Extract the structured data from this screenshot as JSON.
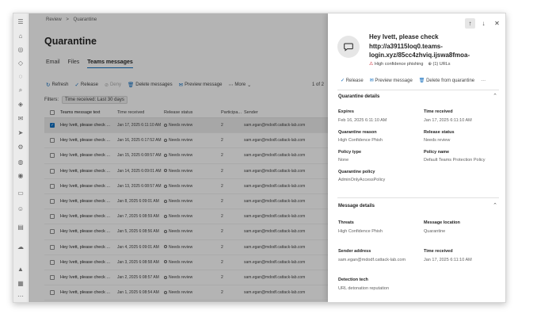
{
  "breadcrumb": {
    "parent": "Review",
    "sep": ">",
    "current": "Quarantine"
  },
  "page_title": "Quarantine",
  "tabs": [
    {
      "label": "Email"
    },
    {
      "label": "Files"
    },
    {
      "label": "Teams messages"
    }
  ],
  "toolbar": {
    "refresh": "Refresh",
    "release": "Release",
    "deny": "Deny",
    "delete": "Delete messages",
    "preview": "Preview message",
    "more": "More",
    "pager": "1 of 2"
  },
  "filters": {
    "label": "Filters:",
    "pill": "Time received: Last 30 days"
  },
  "table": {
    "headers": {
      "text": "Teams message text",
      "time": "Time received",
      "status": "Release status",
      "participants": "Participa...",
      "sender": "Sender"
    },
    "rows": [
      {
        "text": "Hey Ivett, please check ...",
        "time": "Jan 17, 2025 6:11:10 AM",
        "status": "Needs review",
        "participants": "2",
        "sender": "sam.egan@mdodf.cattack-lab.com",
        "selected": true
      },
      {
        "text": "Hey Ivett, please check ...",
        "time": "Jan 16, 2025 6:17:52 AM",
        "status": "Needs review",
        "participants": "2",
        "sender": "sam.egan@mdodf.cattack-lab.com",
        "selected": false
      },
      {
        "text": "Hey Ivett, please check ...",
        "time": "Jan 15, 2025 6:08:57 AM",
        "status": "Needs review",
        "participants": "2",
        "sender": "sam.egan@mdodf.cattack-lab.com",
        "selected": false
      },
      {
        "text": "Hey Ivett, please check ...",
        "time": "Jan 14, 2025 6:09:01 AM",
        "status": "Needs review",
        "participants": "2",
        "sender": "sam.egan@mdodf.cattack-lab.com",
        "selected": false
      },
      {
        "text": "Hey Ivett, please check ...",
        "time": "Jan 13, 2025 6:08:57 AM",
        "status": "Needs review",
        "participants": "2",
        "sender": "sam.egan@mdodf.cattack-lab.com",
        "selected": false
      },
      {
        "text": "Hey Ivett, please check ...",
        "time": "Jan 8, 2025 6:09:01 AM",
        "status": "Needs review",
        "participants": "2",
        "sender": "sam.egan@mdodf.cattack-lab.com",
        "selected": false
      },
      {
        "text": "Hey Ivett, please check ...",
        "time": "Jan 7, 2025 6:08:59 AM",
        "status": "Needs review",
        "participants": "2",
        "sender": "sam.egan@mdodf.cattack-lab.com",
        "selected": false
      },
      {
        "text": "Hey Ivett, please check ...",
        "time": "Jan 5, 2025 6:08:56 AM",
        "status": "Needs review",
        "participants": "2",
        "sender": "sam.egan@mdodf.cattack-lab.com",
        "selected": false
      },
      {
        "text": "Hey Ivett, please check ...",
        "time": "Jan 4, 2025 6:09:01 AM",
        "status": "Needs review",
        "participants": "2",
        "sender": "sam.egan@mdodf.cattack-lab.com",
        "selected": false
      },
      {
        "text": "Hey Ivett, please check ...",
        "time": "Jan 3, 2025 6:08:58 AM",
        "status": "Needs review",
        "participants": "2",
        "sender": "sam.egan@mdodf.cattack-lab.com",
        "selected": false
      },
      {
        "text": "Hey Ivett, please check ...",
        "time": "Jan 2, 2025 6:08:57 AM",
        "status": "Needs review",
        "participants": "2",
        "sender": "sam.egan@mdodf.cattack-lab.com",
        "selected": false
      },
      {
        "text": "Hey Ivett, please check ...",
        "time": "Jan 1, 2025 6:08:54 AM",
        "status": "Needs review",
        "participants": "2",
        "sender": "sam.egan@mdodf.cattack-lab.com",
        "selected": false
      }
    ]
  },
  "panel": {
    "title_lines": [
      "Hey Ivett, please check",
      "http://a39115loq0.teams-",
      "login.xyz/85cc4zhviq.ijswa8fmoa-"
    ],
    "tag_phish": "High confidence phishing",
    "tag_urls": "(1) URLs",
    "actions": {
      "release": "Release",
      "preview": "Preview message",
      "delete": "Delete from quarantine",
      "more": "···"
    },
    "quarantine_details": {
      "header": "Quarantine details",
      "expires_label": "Expires",
      "expires_value": "Feb 16, 2025 6:11:10 AM",
      "time_received_label": "Time received",
      "time_received_value": "Jan 17, 2025 6:11:10 AM",
      "reason_label": "Quarantine reason",
      "reason_value": "High Confidence Phish",
      "release_status_label": "Release status",
      "release_status_value": "Needs review",
      "policy_type_label": "Policy type",
      "policy_type_value": "None",
      "policy_name_label": "Policy name",
      "policy_name_value": "Default Teams Protection Policy",
      "quarantine_policy_label": "Quarantine policy",
      "quarantine_policy_value": "AdminOnlyAccessPolicy"
    },
    "message_details": {
      "header": "Message details",
      "threats_label": "Threats",
      "threats_value": "High Confidence Phish",
      "location_label": "Message location",
      "location_value": "Quarantine",
      "sender_label": "Sender address",
      "sender_value": "sam.egan@mdodf.cattack-lab.com",
      "time_received_label": "Time received",
      "time_received_value": "Jan 17, 2025 6:11:10 AM",
      "detection_label": "Detection tech",
      "detection_value": "URL detonation reputation"
    }
  },
  "colors": {
    "accent": "#0f6cbd",
    "danger": "#c50f1f"
  }
}
